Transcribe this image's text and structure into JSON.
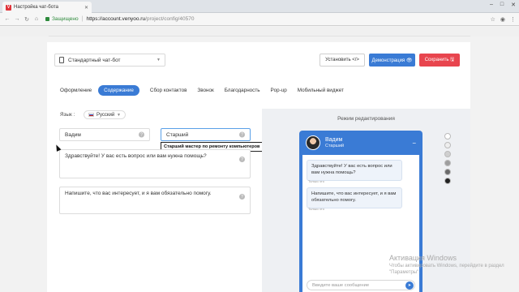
{
  "browser": {
    "tab_title": "Настройка чат-бота",
    "favicon_letter": "V",
    "secure_label": "Защищено",
    "url_host": "https://account.venyoo.ru",
    "url_path": "/project/config/40570"
  },
  "toolbar": {
    "bot_name": "Стандартный чат-бот",
    "install_label": "Установить </>",
    "demo_label": "Демонстрация 👁",
    "save_label": "Сохранить 🖫"
  },
  "tabs": [
    {
      "label": "Оформление",
      "active": false
    },
    {
      "label": "Содержание",
      "active": true
    },
    {
      "label": "Сбор контактов",
      "active": false
    },
    {
      "label": "Звонок",
      "active": false
    },
    {
      "label": "Благодарность",
      "active": false
    },
    {
      "label": "Pop-up",
      "active": false
    },
    {
      "label": "Мобильный виджет",
      "active": false
    }
  ],
  "form": {
    "language_label": "Язык :",
    "language_value": "Русский",
    "name_value": "Вадим",
    "role_value": "Старший",
    "role_tooltip": "Старший мастер по ремонту компьютеров",
    "greeting_value": "Здравствуйте! У вас есть вопрос или вам нужна помощь?",
    "message_value": "Напишите, что вас интересует, и я вам обязательно помогу."
  },
  "preview": {
    "title": "Режим редактирования",
    "agent_name": "Вадим",
    "agent_role": "Старший",
    "bubble1": "Здравствуйте! У вас есть вопрос или вам нужна помощь?",
    "bubble2": "Напишите, что вас интересует, и я вам обязательно помогу.",
    "time1": "Только что",
    "time2": "Только что",
    "input_placeholder": "Введите ваше сообщение",
    "swatch_colors": [
      "#ffffff",
      "#eeeeee",
      "#cfcfcf",
      "#9e9e9e",
      "#6a6a6a",
      "#222222"
    ]
  },
  "watermark": {
    "line1": "Активация Windows",
    "line2": "Чтобы активировать Windows, перейдите в раздел \"Параметры\"."
  },
  "colors": {
    "accent": "#3a7bd5",
    "save": "#e8454e"
  }
}
